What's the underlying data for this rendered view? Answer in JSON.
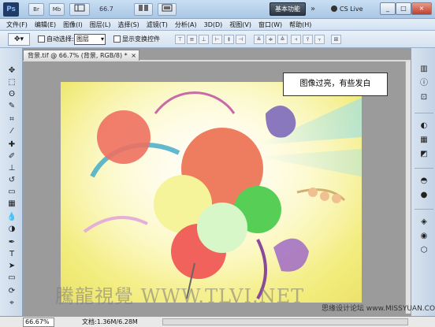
{
  "app": {
    "logo": "Ps",
    "toolbar_buttons": [
      "Br",
      "Mb"
    ],
    "zoom": "66.7",
    "workspace_label": "基本功能",
    "chevron": "»",
    "cslive": "CS Live",
    "window_buttons": [
      "_",
      "□",
      "×"
    ],
    "doc_window_buttons": [
      "_",
      "□",
      "×"
    ]
  },
  "menu": [
    "文件(F)",
    "编辑(E)",
    "图像(I)",
    "图层(L)",
    "选择(S)",
    "滤镜(T)",
    "分析(A)",
    "3D(D)",
    "视图(V)",
    "窗口(W)",
    "帮助(H)"
  ],
  "options": {
    "auto_select_label": "自动选择:",
    "auto_select_value": "图层",
    "show_transform_label": "显示变换控件"
  },
  "document": {
    "tab_title": "背景.tif @ 66.7% (背景, RGB/8) *",
    "tab_close": "×"
  },
  "callout": "图像过亮，有些发白",
  "watermark": "騰龍視覺 WWW.TLVI.NET",
  "status": {
    "zoom": "66.67%",
    "doc_info": "文档:1.36M/6.28M"
  },
  "site_watermark": "思缘设计论坛 www.MISSYUAN.COM",
  "icons": {
    "toolbox": [
      "move-icon",
      "marquee-icon",
      "lasso-icon",
      "quick-select-icon",
      "crop-icon",
      "eyedropper-icon",
      "healing-icon",
      "brush-icon",
      "stamp-icon",
      "history-brush-icon",
      "eraser-icon",
      "gradient-icon",
      "blur-icon",
      "dodge-icon",
      "pen-icon",
      "type-icon",
      "path-select-icon",
      "shape-icon",
      "3d-rotate-icon",
      "3d-camera-icon"
    ],
    "right_panel": [
      "histogram-icon",
      "info-icon",
      "navigator-icon",
      "color-icon",
      "swatches-icon",
      "styles-icon",
      "adjustments-icon",
      "masks-icon",
      "layers-icon",
      "channels-icon",
      "paths-icon"
    ]
  },
  "colors": {
    "accent_title": "#a9c6e5",
    "workspace_button": "#2c3642",
    "canvas_yellow": "#f2ec7c"
  }
}
